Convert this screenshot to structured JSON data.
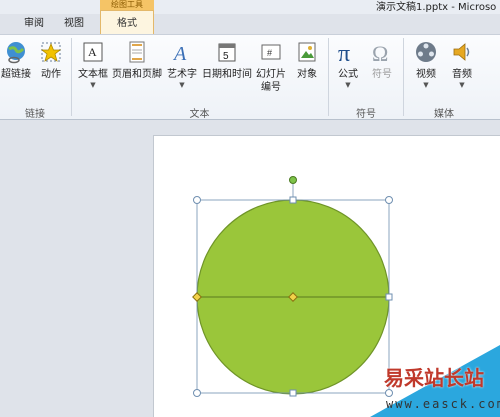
{
  "titlebar": {
    "doc_title": "演示文稿1.pptx - Microso"
  },
  "tabs": {
    "review": "审阅",
    "view": "视图",
    "context_top": "绘图工具",
    "format": "格式"
  },
  "ribbon": {
    "link_group": {
      "label": "链接",
      "hyperlink": "超链接",
      "action": "动作"
    },
    "text_group": {
      "label": "文本",
      "textbox": "文本框",
      "header_footer": "页眉和页脚",
      "wordart": "艺术字",
      "datetime": "日期和时间",
      "slide_number_1": "幻灯片",
      "slide_number_2": "编号",
      "object": "对象"
    },
    "symbols_group": {
      "label": "符号",
      "equation": "公式",
      "symbol": "符号"
    },
    "media_group": {
      "label": "媒体",
      "video": "视频",
      "audio": "音频"
    }
  },
  "watermark": {
    "text": "易采站长站",
    "url": "www.easck.com"
  },
  "colors": {
    "shape_fill": "#9ac63a",
    "shape_stroke": "#6f9428",
    "accent": "#2ba7de"
  }
}
